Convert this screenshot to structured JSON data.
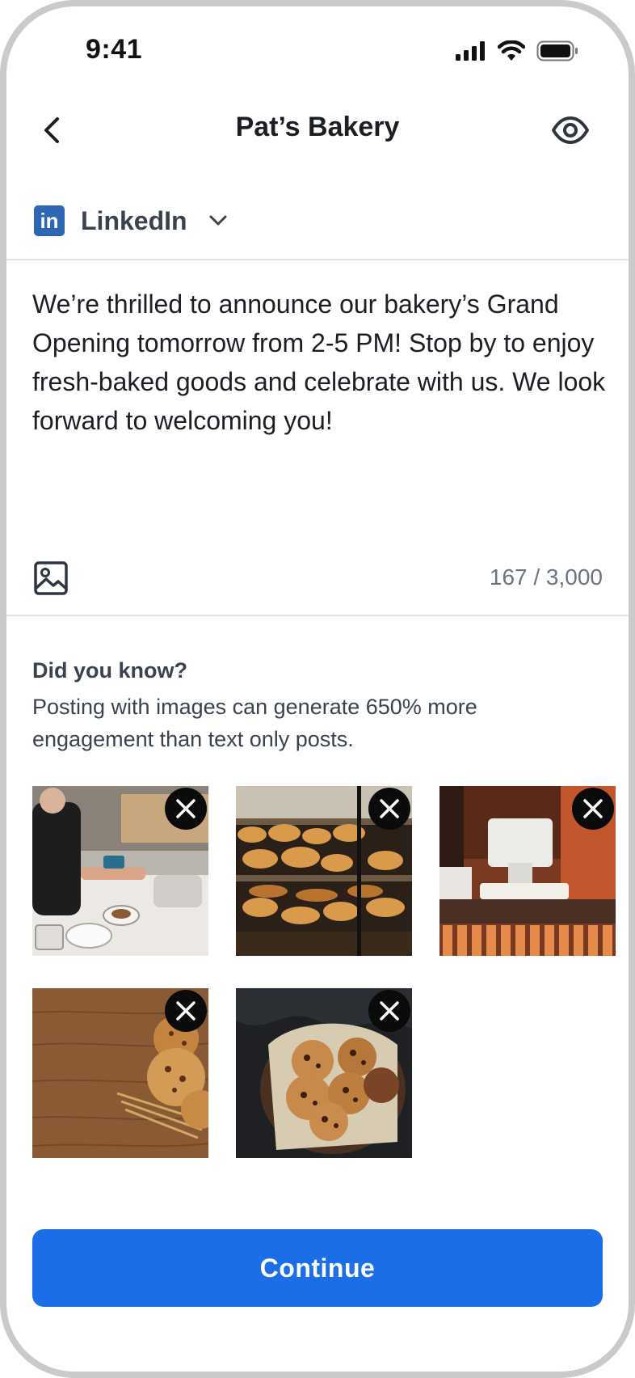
{
  "status_bar": {
    "time": "9:41"
  },
  "header": {
    "title": "Pat’s Bakery"
  },
  "platform": {
    "icon_text": "in",
    "label": "LinkedIn"
  },
  "post": {
    "text": "We’re thrilled to announce our bakery’s Grand Opening tomorrow from 2-5 PM! Stop by to enjoy fresh-baked goods and celebrate with us. We look forward to welcoming you!",
    "char_count": "167 / 3,000"
  },
  "tip": {
    "title": "Did you know?",
    "body": "Posting with images can generate 650% more engagement than text only posts."
  },
  "images": [
    {
      "name": "cafe-counter-payment"
    },
    {
      "name": "pastry-display-case"
    },
    {
      "name": "cafe-register"
    },
    {
      "name": "cookies-on-wood"
    },
    {
      "name": "cookie-basket"
    }
  ],
  "actions": {
    "continue_label": "Continue"
  },
  "colors": {
    "accent": "#1c6ee8",
    "linkedin": "#2d66b3",
    "text": "#1b1f24",
    "muted": "#6b7380"
  }
}
